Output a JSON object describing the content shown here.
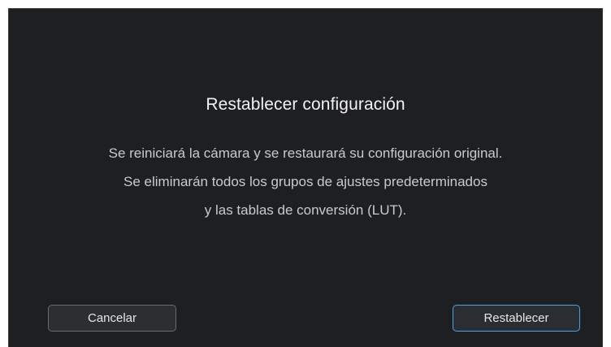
{
  "dialog": {
    "title": "Restablecer configuración",
    "message_lines": [
      "Se reiniciará la cámara y se restaurará su configuración original.",
      "Se eliminarán todos los grupos de ajustes predeterminados",
      "y las tablas de conversión (LUT)."
    ],
    "cancel_label": "Cancelar",
    "confirm_label": "Restablecer"
  },
  "colors": {
    "background": "#1e1f21",
    "text": "#f2f2f2",
    "accent_border": "#4aa3e8"
  }
}
